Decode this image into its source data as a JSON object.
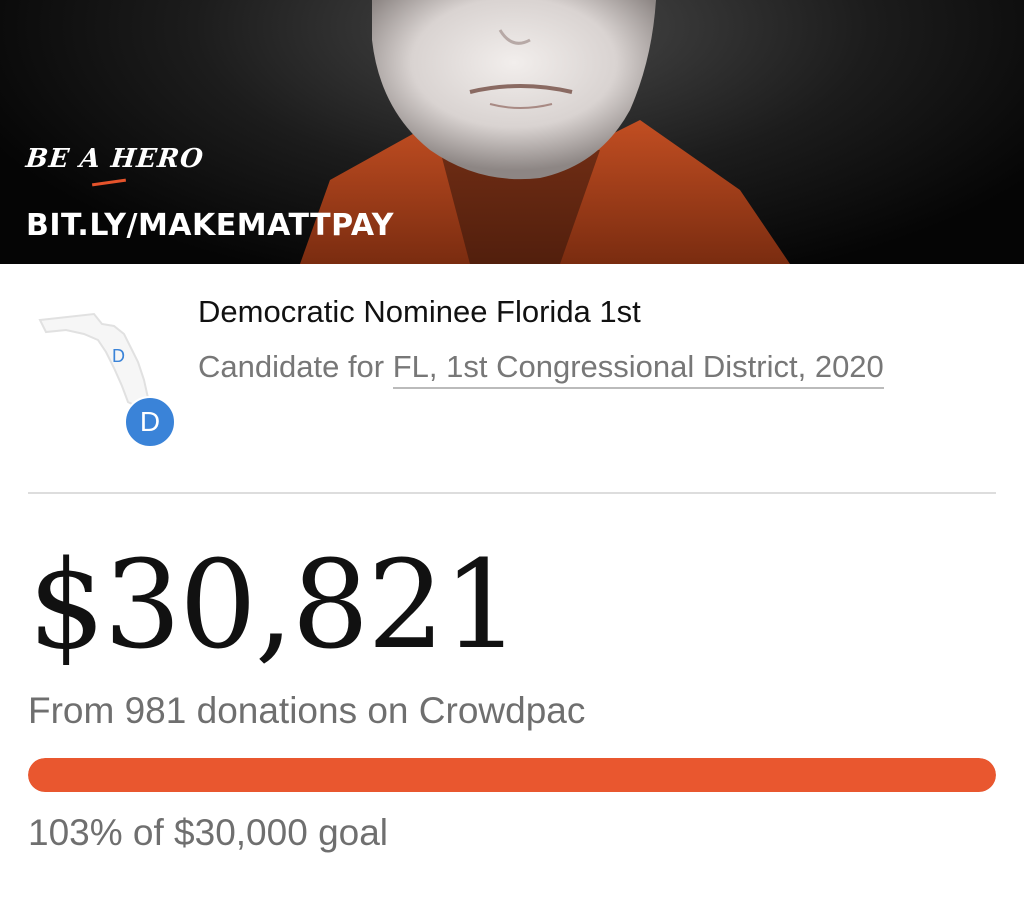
{
  "hero": {
    "tagline": "BE A HERO",
    "url": "BIT.LY/MAKEMATTPAY"
  },
  "candidate": {
    "title": "Democratic Nominee Florida 1st",
    "subtitle_prefix": "Candidate for ",
    "subtitle_link": "FL, 1st Congressional District, 2020",
    "map_label": "D",
    "party_badge": "D",
    "map_icon": "florida-map-icon",
    "party_color": "#3a83d8"
  },
  "fundraising": {
    "amount": "$30,821",
    "donations_text": "From 981 donations on Crowdpac",
    "progress_fraction": 1.0,
    "progress_color": "#e9572f",
    "goal_text": "103% of $30,000 goal"
  }
}
